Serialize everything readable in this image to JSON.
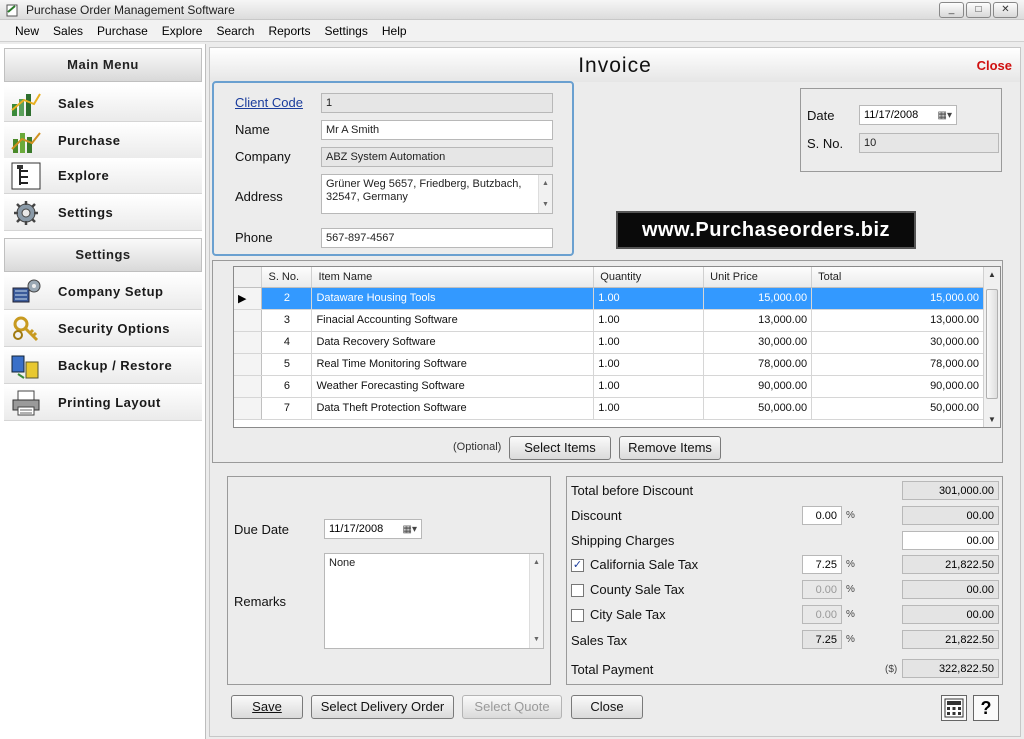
{
  "window": {
    "title": "Purchase Order Management Software",
    "min": "_",
    "max": "□",
    "close": "✕"
  },
  "menu": [
    "New",
    "Sales",
    "Purchase",
    "Explore",
    "Search",
    "Reports",
    "Settings",
    "Help"
  ],
  "sidebar": {
    "main_header": "Main Menu",
    "main_items": [
      {
        "label": "Sales",
        "icon": "sales-chart-icon"
      },
      {
        "label": "Purchase",
        "icon": "purchase-chart-icon"
      },
      {
        "label": "Explore",
        "icon": "tree-icon"
      },
      {
        "label": "Settings",
        "icon": "gear-icon"
      }
    ],
    "settings_header": "Settings",
    "settings_items": [
      {
        "label": "Company Setup",
        "icon": "company-setup-icon"
      },
      {
        "label": "Security Options",
        "icon": "keys-icon"
      },
      {
        "label": "Backup / Restore",
        "icon": "backup-icon"
      },
      {
        "label": "Printing Layout",
        "icon": "printer-icon"
      }
    ]
  },
  "invoice": {
    "title": "Invoice",
    "close_link": "Close",
    "client": {
      "code_label": "Client Code",
      "code": "1",
      "name_label": "Name",
      "name": "Mr A Smith",
      "company_label": "Company",
      "company": "ABZ System Automation",
      "address_label": "Address",
      "address": "Grüner Weg 5657, Friedberg, Butzbach, 32547, Germany",
      "phone_label": "Phone",
      "phone": "567-897-4567"
    },
    "date_label": "Date",
    "date": "11/17/2008",
    "sno_label": "S. No.",
    "sno": "10",
    "banner": "www.Purchaseorders.biz"
  },
  "items": {
    "columns": [
      "S. No.",
      "Item Name",
      "Quantity",
      "Unit Price",
      "Total"
    ],
    "rows": [
      {
        "sno": "2",
        "name": "Dataware Housing Tools",
        "qty": "1.00",
        "price": "15,000.00",
        "total": "15,000.00"
      },
      {
        "sno": "3",
        "name": "Finacial Accounting Software",
        "qty": "1.00",
        "price": "13,000.00",
        "total": "13,000.00"
      },
      {
        "sno": "4",
        "name": "Data Recovery Software",
        "qty": "1.00",
        "price": "30,000.00",
        "total": "30,000.00"
      },
      {
        "sno": "5",
        "name": "Real Time Monitoring Software",
        "qty": "1.00",
        "price": "78,000.00",
        "total": "78,000.00"
      },
      {
        "sno": "6",
        "name": "Weather Forecasting Software",
        "qty": "1.00",
        "price": "90,000.00",
        "total": "90,000.00"
      },
      {
        "sno": "7",
        "name": "Data Theft Protection Software",
        "qty": "1.00",
        "price": "50,000.00",
        "total": "50,000.00"
      }
    ],
    "optional": "(Optional)",
    "select_btn": "Select Items",
    "remove_btn": "Remove Items"
  },
  "due": {
    "label": "Due Date",
    "date": "11/17/2008",
    "remarks_label": "Remarks",
    "remarks": "None"
  },
  "totals": {
    "before_discount_label": "Total before Discount",
    "before_discount": "301,000.00",
    "discount_label": "Discount",
    "discount_pct": "0.00",
    "discount": "00.00",
    "shipping_label": "Shipping Charges",
    "shipping": "00.00",
    "ca_label": "California Sale Tax",
    "ca_pct": "7.25",
    "ca": "21,822.50",
    "county_label": "County Sale Tax",
    "county_pct": "0.00",
    "county": "00.00",
    "city_label": "City Sale Tax",
    "city_pct": "0.00",
    "city": "00.00",
    "sales_tax_label": "Sales Tax",
    "sales_tax_pct": "7.25",
    "sales_tax": "21,822.50",
    "payment_label": "Total Payment",
    "currency": "($)",
    "payment": "322,822.50",
    "pct_sign": "%"
  },
  "buttons": {
    "save": "Save",
    "delivery": "Select Delivery Order",
    "quote": "Select Quote",
    "close": "Close"
  }
}
